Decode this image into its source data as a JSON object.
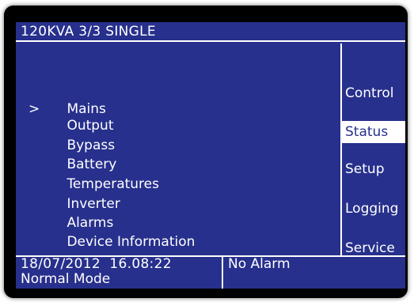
{
  "header": {
    "title": "120KVA   3/3 SINGLE"
  },
  "menu": {
    "cursor": ">",
    "items": [
      "Mains",
      "Output",
      "Bypass",
      "Battery",
      "Temperatures",
      "Inverter",
      "Alarms",
      "Device Information"
    ]
  },
  "side_menu": {
    "items": [
      "Control",
      "Status",
      "Setup",
      "Logging",
      "Service"
    ],
    "active": "Status"
  },
  "status": {
    "datetime": "18/07/2012  16.08:22",
    "mode": "Normal Mode",
    "alarm": "No Alarm"
  },
  "colors": {
    "screen_background": "#27308c",
    "text": "#ffffff",
    "bezel": "#000000"
  }
}
